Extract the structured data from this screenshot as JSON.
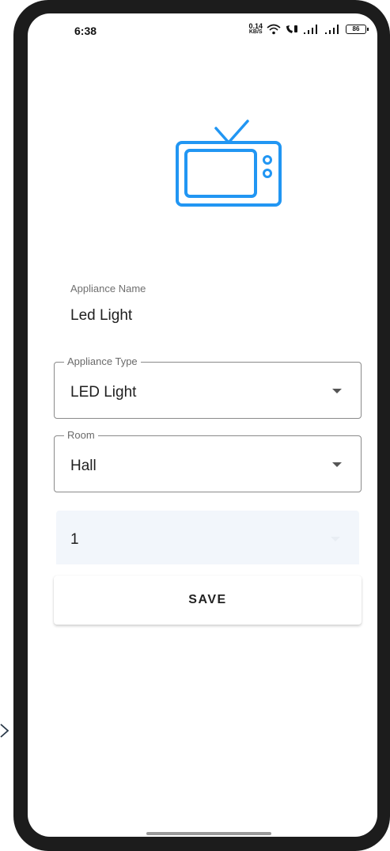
{
  "status_bar": {
    "time": "6:38",
    "net_speed_value": "0.14",
    "net_speed_unit": "KB/S",
    "battery": "86"
  },
  "header_icon": "tv-icon",
  "form": {
    "appliance_name": {
      "label": "Appliance Name",
      "value": "Led Light"
    },
    "appliance_type": {
      "label": "Appliance Type",
      "value": "LED Light"
    },
    "room": {
      "label": "Room",
      "value": "Hall"
    },
    "switch_field": {
      "label": "",
      "value": "1"
    },
    "save_label": "SAVE"
  },
  "colors": {
    "accent_icon": "#2196F3",
    "filled_field_bg": "#f2f6fb"
  }
}
